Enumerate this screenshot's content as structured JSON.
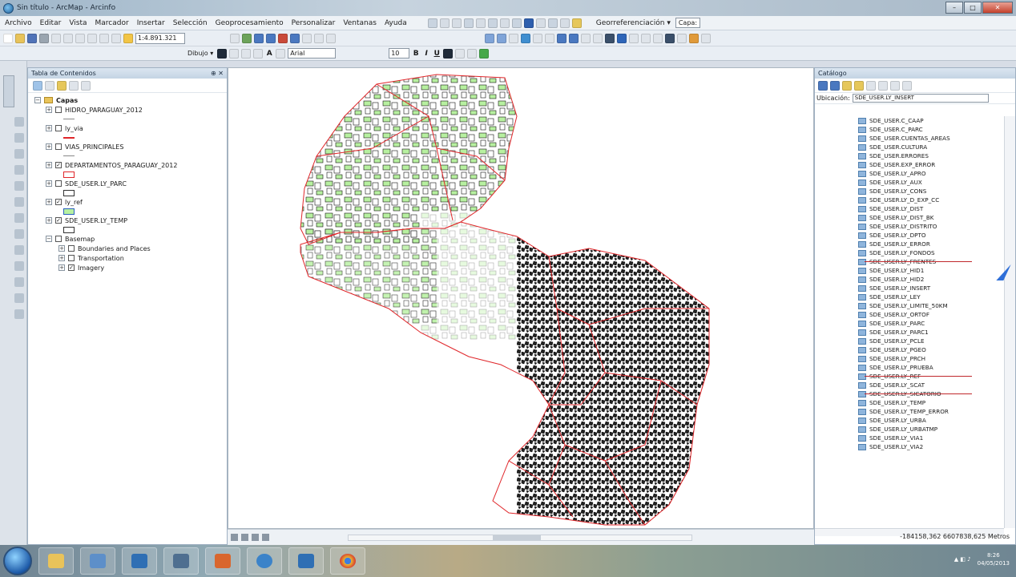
{
  "window": {
    "title": "Sin título - ArcMap - Arcinfo"
  },
  "menu": [
    "Archivo",
    "Editar",
    "Vista",
    "Marcador",
    "Insertar",
    "Selección",
    "Geoprocesamiento",
    "Personalizar",
    "Ventanas",
    "Ayuda"
  ],
  "georeferencing": {
    "label": "Georreferenciación ▾",
    "layer_combo": "Capa:"
  },
  "toolbar": {
    "scale": "1:4.891.321",
    "drawing_label": "Dibujo ▾",
    "font": "Arial",
    "font_size": "10",
    "bold": "B",
    "italic": "I",
    "underline": "U",
    "text_tool": "A"
  },
  "toc": {
    "title": "Tabla de Contenidos",
    "root": "Capas",
    "layers": [
      {
        "name": "HIDRO_PARAGUAY_2012",
        "checked": false,
        "symbol": "grey-line"
      },
      {
        "name": "ly_via",
        "checked": false,
        "symbol": "red-line"
      },
      {
        "name": "VIAS_PRINCIPALES",
        "checked": false,
        "symbol": "grey-line"
      },
      {
        "name": "DEPARTAMENTOS_PARAGUAY_2012",
        "checked": true,
        "symbol": "red-box"
      },
      {
        "name": "SDE_USER.LY_PARC",
        "checked": false,
        "symbol": "black-box"
      },
      {
        "name": "ly_ref",
        "checked": true,
        "symbol": "green-box"
      },
      {
        "name": "SDE_USER.LY_TEMP",
        "checked": true,
        "symbol": "black-box"
      }
    ],
    "basemap": {
      "name": "Basemap",
      "children": [
        {
          "name": "Boundaries and Places",
          "checked": false
        },
        {
          "name": "Transportation",
          "checked": false
        },
        {
          "name": "Imagery",
          "checked": true
        }
      ]
    }
  },
  "catalog": {
    "title": "Catálogo",
    "location_label": "Ubicación:",
    "location_value": "SDE_USER.LY_INSERT",
    "items": [
      {
        "name": "SDE_USER.C_CAAP",
        "struck": false
      },
      {
        "name": "SDE_USER.C_PARC",
        "struck": false
      },
      {
        "name": "SDE_USER.CUENTAS_AREAS",
        "struck": false
      },
      {
        "name": "SDE_USER.CULTURA",
        "struck": false
      },
      {
        "name": "SDE_USER.ERRORES",
        "struck": false
      },
      {
        "name": "SDE_USER.EXP_ERROR",
        "struck": false
      },
      {
        "name": "SDE_USER.LY_APRO",
        "struck": false
      },
      {
        "name": "SDE_USER.LY_AUX",
        "struck": false
      },
      {
        "name": "SDE_USER.LY_CONS",
        "struck": false
      },
      {
        "name": "SDE_USER.LY_D_EXP_CC",
        "struck": false
      },
      {
        "name": "SDE_USER.LY_DIST",
        "struck": false
      },
      {
        "name": "SDE_USER.LY_DIST_BK",
        "struck": false
      },
      {
        "name": "SDE_USER.LY_DISTRITO",
        "struck": false
      },
      {
        "name": "SDE_USER.LY_DPTO",
        "struck": false
      },
      {
        "name": "SDE_USER.LY_ERROR",
        "struck": false
      },
      {
        "name": "SDE_USER.LY_FONDOS",
        "struck": false
      },
      {
        "name": "SDE_USER.LY_FRENTES",
        "struck": true
      },
      {
        "name": "SDE_USER.LY_HID1",
        "struck": false
      },
      {
        "name": "SDE_USER.LY_HID2",
        "struck": false
      },
      {
        "name": "SDE_USER.LY_INSERT",
        "struck": false
      },
      {
        "name": "SDE_USER.LY_LEY",
        "struck": false
      },
      {
        "name": "SDE_USER.LY_LIMITE_50KM",
        "struck": false
      },
      {
        "name": "SDE_USER.LY_ORTOF",
        "struck": false
      },
      {
        "name": "SDE_USER.LY_PARC",
        "struck": false
      },
      {
        "name": "SDE_USER.LY_PARC1",
        "struck": false
      },
      {
        "name": "SDE_USER.LY_PCLE",
        "struck": false
      },
      {
        "name": "SDE_USER.LY_PGEO",
        "struck": false
      },
      {
        "name": "SDE_USER.LY_PRCH",
        "struck": false
      },
      {
        "name": "SDE_USER.LY_PRUEBA",
        "struck": false
      },
      {
        "name": "SDE_USER.LY_REF",
        "struck": true
      },
      {
        "name": "SDE_USER.LY_SCAT",
        "struck": false
      },
      {
        "name": "SDE_USER.LY_SICATORIO",
        "struck": true
      },
      {
        "name": "SDE_USER.LY_TEMP",
        "struck": false
      },
      {
        "name": "SDE_USER.LY_TEMP_ERROR",
        "struck": false
      },
      {
        "name": "SDE_USER.LY_URBA",
        "struck": false
      },
      {
        "name": "SDE_USER.LY_URBATMP",
        "struck": false
      },
      {
        "name": "SDE_USER.LY_VIA1",
        "struck": false
      },
      {
        "name": "SDE_USER.LY_VIA2",
        "struck": false
      }
    ]
  },
  "status": {
    "coordinates": "-184158,362  6607838,625 Metros"
  },
  "taskbar": {
    "clock_time": "8:26",
    "clock_date": "04/05/2013"
  },
  "colors": {
    "department_border": "#e0262a",
    "parcel_fill": "#b7f0a0",
    "parcel_stroke": "#111111"
  }
}
